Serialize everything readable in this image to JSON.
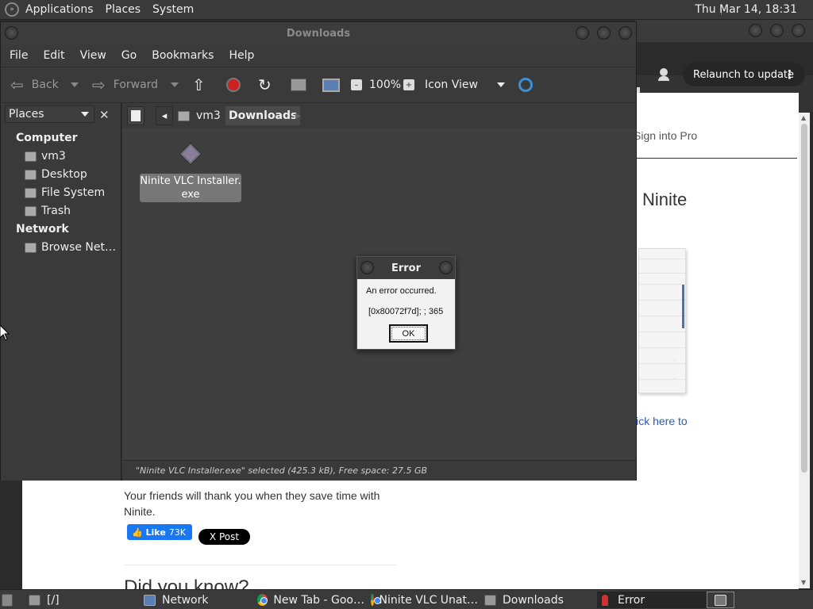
{
  "top_panel": {
    "menus": [
      "Applications",
      "Places",
      "System"
    ],
    "clock": "Thu Mar 14, 18:31"
  },
  "browser": {
    "relaunch_label": "Relaunch to update",
    "page": {
      "signin": "Sign into Pro",
      "heading": "Ninite",
      "click_here": "lick here to",
      "friends": "Your friends will thank you when they save time with Ninite.",
      "fb_like": "Like",
      "fb_count": "73K",
      "x_post": "X Post",
      "did_you_know": "Did you know?"
    }
  },
  "file_manager": {
    "title": "Downloads",
    "menus": [
      "File",
      "Edit",
      "View",
      "Go",
      "Bookmarks",
      "Help"
    ],
    "toolbar": {
      "back": "Back",
      "forward": "Forward",
      "zoom": "100%",
      "view_mode": "Icon View"
    },
    "sidebar": {
      "combo": "Places",
      "sections": [
        {
          "title": "Computer",
          "items": [
            "vm3",
            "Desktop",
            "File System",
            "Trash"
          ]
        },
        {
          "title": "Network",
          "items": [
            "Browse Net…"
          ]
        }
      ]
    },
    "path": [
      "vm3",
      "Downloads"
    ],
    "files": [
      {
        "name": "Ninite VLC Installer.\nexe",
        "icon": "installer-icon"
      }
    ],
    "status": "\"Ninite VLC Installer.exe\" selected (425.3 kB), Free space: 27.5 GB"
  },
  "error_dialog": {
    "title": "Error",
    "message": "An error occurred.",
    "code": "[0x80072f7d]; ; 365",
    "ok_label": "OK"
  },
  "taskbar": {
    "items": [
      "[/]",
      "Network",
      "New Tab - Goo…",
      "Ninite VLC Unat…",
      "Downloads",
      "Error"
    ]
  }
}
